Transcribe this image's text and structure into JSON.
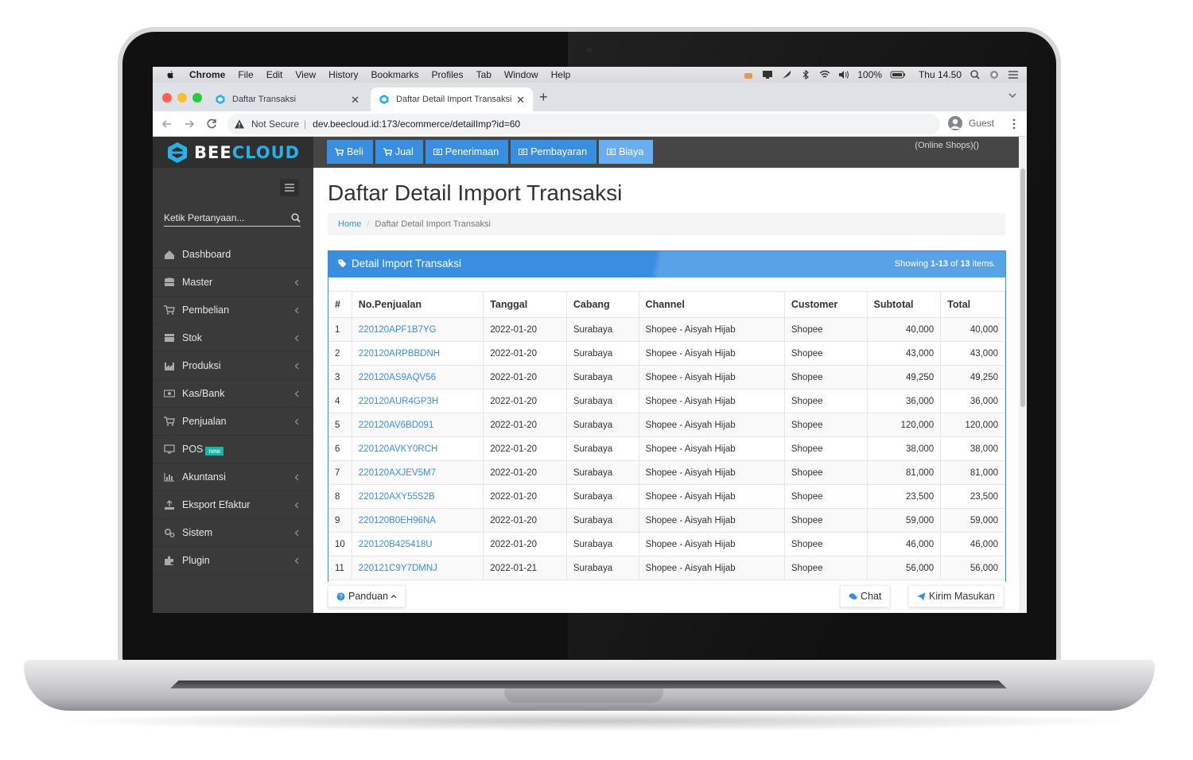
{
  "menubar": {
    "app": "Chrome",
    "items": [
      "File",
      "Edit",
      "View",
      "History",
      "Bookmarks",
      "Profiles",
      "Tab",
      "Window",
      "Help"
    ],
    "battery": "100%",
    "clock": "Thu 14.50"
  },
  "browser": {
    "tabs": [
      {
        "title": "Daftar Transaksi",
        "active": false
      },
      {
        "title": "Daftar Detail Import Transaksi",
        "active": true
      }
    ],
    "security": "Not Secure",
    "url": "dev.beecloud.id:173/ecommerce/detailImp?id=60",
    "profile": "Guest"
  },
  "app": {
    "brand": {
      "part1": "BEE",
      "part2": "CLOUD"
    },
    "topnav": [
      "Beli",
      "Jual",
      "Penerimaan",
      "Pembayaran",
      "Biaya"
    ],
    "store": "(Online Shops)()",
    "search_placeholder": "Ketik Pertanyaan...",
    "menu": [
      {
        "label": "Dashboard",
        "icon": "dashboard-icon",
        "chevron": false
      },
      {
        "label": "Master",
        "icon": "database-icon",
        "chevron": true
      },
      {
        "label": "Pembelian",
        "icon": "cart-icon",
        "chevron": true
      },
      {
        "label": "Stok",
        "icon": "box-icon",
        "chevron": true
      },
      {
        "label": "Produksi",
        "icon": "factory-icon",
        "chevron": true
      },
      {
        "label": "Kas/Bank",
        "icon": "money-icon",
        "chevron": true
      },
      {
        "label": "Penjualan",
        "icon": "cart-icon",
        "chevron": true
      },
      {
        "label": "POS",
        "icon": "monitor-icon",
        "chevron": false,
        "badge": "new"
      },
      {
        "label": "Akuntansi",
        "icon": "bar-chart-icon",
        "chevron": true
      },
      {
        "label": "Eksport Efaktur",
        "icon": "export-icon",
        "chevron": true
      },
      {
        "label": "Sistem",
        "icon": "cogs-icon",
        "chevron": true
      },
      {
        "label": "Plugin",
        "icon": "puzzle-icon",
        "chevron": true
      }
    ]
  },
  "page": {
    "title": "Daftar Detail Import Transaksi",
    "breadcrumb": {
      "home": "Home",
      "current": "Daftar Detail Import Transaksi"
    },
    "panel_title": "Detail Import Transaksi",
    "summary": {
      "prefix": "Showing ",
      "range": "1-13",
      "mid": " of ",
      "total": "13",
      "suffix": " items."
    },
    "columns": [
      "#",
      "No.Penjualan",
      "Tanggal",
      "Cabang",
      "Channel",
      "Customer",
      "Subtotal",
      "Total"
    ],
    "rows": [
      [
        "1",
        "220120APF1B7YG",
        "2022-01-20",
        "Surabaya",
        "Shopee - Aisyah Hijab",
        "Shopee",
        "40,000",
        "40,000"
      ],
      [
        "2",
        "220120ARPBBDNH",
        "2022-01-20",
        "Surabaya",
        "Shopee - Aisyah Hijab",
        "Shopee",
        "43,000",
        "43,000"
      ],
      [
        "3",
        "220120AS9AQV56",
        "2022-01-20",
        "Surabaya",
        "Shopee - Aisyah Hijab",
        "Shopee",
        "49,250",
        "49,250"
      ],
      [
        "4",
        "220120AUR4GP3H",
        "2022-01-20",
        "Surabaya",
        "Shopee - Aisyah Hijab",
        "Shopee",
        "36,000",
        "36,000"
      ],
      [
        "5",
        "220120AV6BD091",
        "2022-01-20",
        "Surabaya",
        "Shopee - Aisyah Hijab",
        "Shopee",
        "120,000",
        "120,000"
      ],
      [
        "6",
        "220120AVKY0RCH",
        "2022-01-20",
        "Surabaya",
        "Shopee - Aisyah Hijab",
        "Shopee",
        "38,000",
        "38,000"
      ],
      [
        "7",
        "220120AXJEV5M7",
        "2022-01-20",
        "Surabaya",
        "Shopee - Aisyah Hijab",
        "Shopee",
        "81,000",
        "81,000"
      ],
      [
        "8",
        "220120AXY55S2B",
        "2022-01-20",
        "Surabaya",
        "Shopee - Aisyah Hijab",
        "Shopee",
        "23,500",
        "23,500"
      ],
      [
        "9",
        "220120B0EH96NA",
        "2022-01-20",
        "Surabaya",
        "Shopee - Aisyah Hijab",
        "Shopee",
        "59,000",
        "59,000"
      ],
      [
        "10",
        "220120B425418U",
        "2022-01-20",
        "Surabaya",
        "Shopee - Aisyah Hijab",
        "Shopee",
        "46,000",
        "46,000"
      ],
      [
        "11",
        "220121C9Y7DMNJ",
        "2022-01-21",
        "Surabaya",
        "Shopee - Aisyah Hijab",
        "Shopee",
        "56,000",
        "56,000"
      ]
    ],
    "footer": {
      "guide": "Panduan",
      "chat": "Chat",
      "feedback": "Kirim Masukan"
    }
  },
  "colors": {
    "accent": "#3a8ee0",
    "brand": "#2ab0e8",
    "sidebar": "#3a3a3a",
    "topbar": "#464646"
  }
}
